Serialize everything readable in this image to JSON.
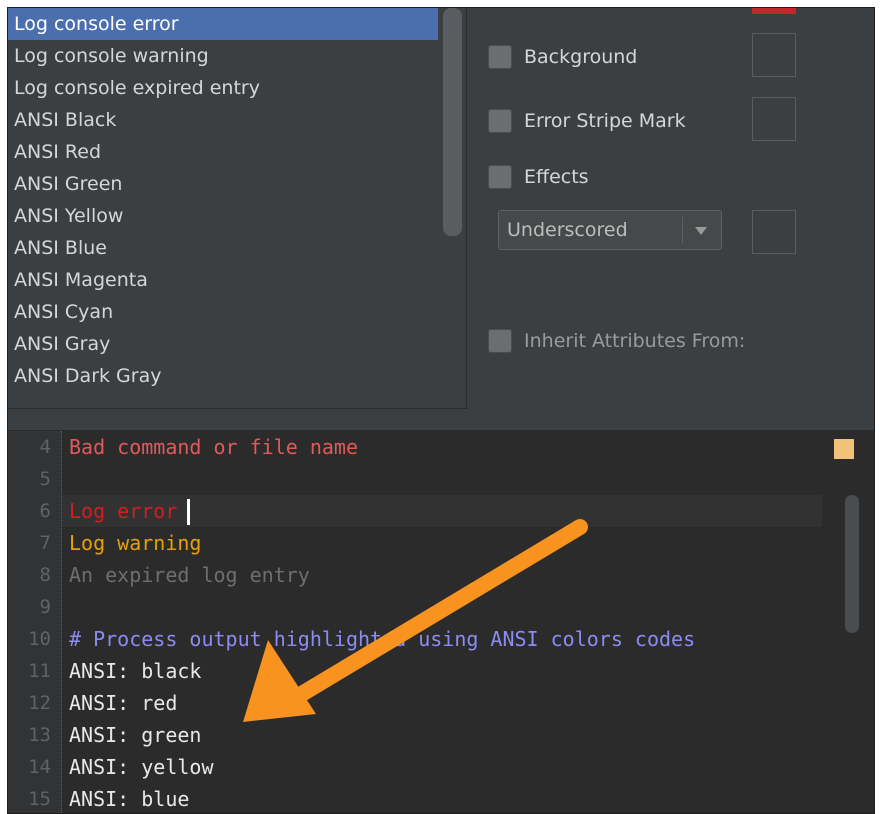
{
  "list": {
    "items": [
      "Log console error",
      "Log console warning",
      "Log console expired entry",
      "ANSI Black",
      "ANSI Red",
      "ANSI Green",
      "ANSI Yellow",
      "ANSI Blue",
      "ANSI Magenta",
      "ANSI Cyan",
      "ANSI Gray",
      "ANSI Dark Gray"
    ],
    "selected_index": 0
  },
  "options": {
    "background": "Background",
    "error_stripe": "Error Stripe Mark",
    "effects": "Effects",
    "effect_type": "Underscored",
    "inherit": "Inherit Attributes From:"
  },
  "editor": {
    "lines": [
      {
        "num": "4",
        "text": "Bad command or file name",
        "color": "#e05a5a"
      },
      {
        "num": "5",
        "text": "",
        "color": "#a9b7c6"
      },
      {
        "num": "6",
        "text": "Log error",
        "color": "#d01f1f"
      },
      {
        "num": "7",
        "text": "Log warning",
        "color": "#e5a00d"
      },
      {
        "num": "8",
        "text": "An expired log entry",
        "color": "#6e6e6e"
      },
      {
        "num": "9",
        "text": "",
        "color": "#a9b7c6"
      },
      {
        "num": "10",
        "text": "# Process output highlighted using ANSI colors codes",
        "color": "#8c8cf0"
      },
      {
        "num": "11",
        "text": "ANSI: black",
        "color": "#e8e8e8"
      },
      {
        "num": "12",
        "text": "ANSI: red",
        "color": "#e8e8e8"
      },
      {
        "num": "13",
        "text": "ANSI: green",
        "color": "#e8e8e8"
      },
      {
        "num": "14",
        "text": "ANSI: yellow",
        "color": "#e8e8e8"
      },
      {
        "num": "15",
        "text": "ANSI: blue",
        "color": "#e8e8e8"
      }
    ]
  },
  "colors": {
    "selection": "#4b6eaf",
    "arrow": "#f7931e",
    "marker": "#f0c27a"
  }
}
